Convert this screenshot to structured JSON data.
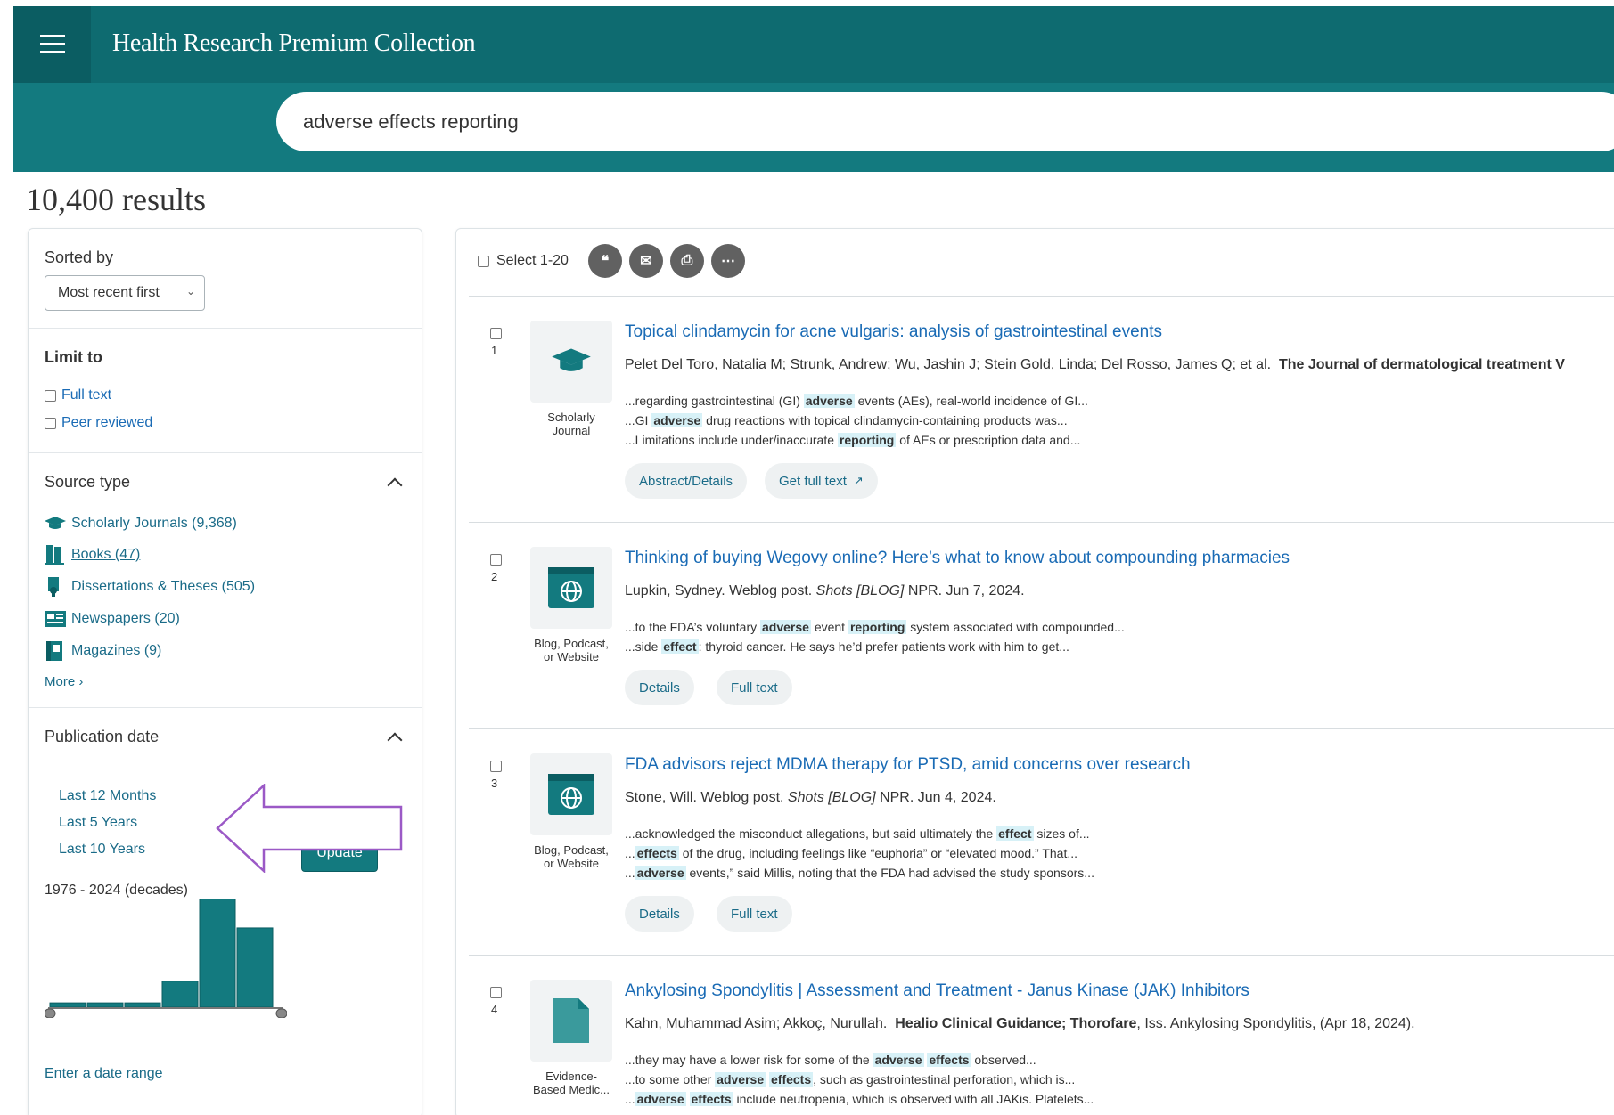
{
  "app": {
    "title": "Health Research Premium Collection"
  },
  "search": {
    "query": "adverse effects reporting"
  },
  "results_count": "10,400 results",
  "sidebar": {
    "sorted_by_label": "Sorted by",
    "sort_value": "Most recent first",
    "limit_to_label": "Limit to",
    "limit_options": [
      "Full text",
      "Peer reviewed"
    ],
    "source_type_label": "Source type",
    "source_types": [
      "Scholarly Journals (9,368)",
      "Books (47)",
      "Dissertations & Theses (505)",
      "Newspapers (20)",
      "Magazines (9)"
    ],
    "more_label": "More ›",
    "publication_date_label": "Publication date",
    "date_links": [
      "Last 12 Months",
      "Last 5 Years",
      "Last 10 Years"
    ],
    "range_caption": "1976 - 2024 (decades)",
    "histogram_levels": [
      0.04,
      0.04,
      0.04,
      0.24,
      1.0,
      0.73
    ],
    "enter_range_label": "Enter a date range",
    "update_label": "Update"
  },
  "toolbar": {
    "select_label": "Select 1-20",
    "icons": [
      "cite-icon",
      "email-icon",
      "print-icon",
      "more-icon"
    ]
  },
  "results": [
    {
      "num": "1",
      "type_icon": "graduation-cap-icon",
      "type_label": [
        "Scholarly",
        "Journal"
      ],
      "title": "Topical clindamycin for acne vulgaris: analysis of gastrointestinal events",
      "meta_plain": "Pelet Del Toro, Natalia M; Strunk, Andrew; Wu, Jashin J; Stein Gold, Linda; Del Rosso, James Q; et al.",
      "meta_bold": "The Journal of dermatological treatment V",
      "snippets": [
        [
          "...regarding gastrointestinal (GI) ",
          "adverse",
          " events (AEs), real-world incidence of GI..."
        ],
        [
          "...GI ",
          "adverse",
          " drug reactions with topical clindamycin-containing products was..."
        ],
        [
          "...Limitations include under/inaccurate ",
          "reporting",
          " of AEs or prescription data and..."
        ]
      ],
      "buttons": [
        "Abstract/Details",
        "Get full text"
      ]
    },
    {
      "num": "2",
      "type_icon": "web-globe-icon",
      "type_label": [
        "Blog, Podcast,",
        "or Website"
      ],
      "title": "Thinking of buying Wegovy online? Here’s what to know about compounding pharmacies",
      "meta_plain": "Lupkin, Sydney.  Weblog post.",
      "meta_italic": "Shots [BLOG]",
      "meta_tail": " NPR.  Jun 7, 2024.",
      "snippets2": [
        [
          "...to the FDA’s voluntary ",
          "adverse",
          " event ",
          "reporting",
          " system associated with compounded..."
        ],
        [
          "...side ",
          "effect",
          ": thyroid cancer. He says he’d prefer patients work with him to get..."
        ]
      ],
      "buttons": [
        "Details",
        "Full text"
      ]
    },
    {
      "num": "3",
      "type_icon": "web-globe-icon",
      "type_label": [
        "Blog, Podcast,",
        "or Website"
      ],
      "title": "FDA advisors reject MDMA therapy for PTSD, amid concerns over research",
      "meta_plain": "Stone, Will.  Weblog post.",
      "meta_italic": "Shots [BLOG]",
      "meta_tail": " NPR.  Jun 4, 2024.",
      "snippets": [
        [
          "...acknowledged the misconduct allegations, but said ultimately the ",
          "effect",
          " sizes of..."
        ],
        [
          "...",
          "effects",
          " of the drug, including feelings like “euphoria” or “elevated mood.” That..."
        ],
        [
          "...",
          "adverse",
          " events,” said Millis, noting that the FDA had advised the study sponsors..."
        ]
      ],
      "buttons": [
        "Details",
        "Full text"
      ]
    },
    {
      "num": "4",
      "type_icon": "document-icon",
      "type_label": [
        "Evidence-",
        "Based Medic..."
      ],
      "title": "Ankylosing Spondylitis | Assessment and Treatment - Janus Kinase (JAK) Inhibitors",
      "meta_plain": "Kahn, Muhammad Asim; Akkoç, Nurullah.",
      "meta_bold": "Healio Clinical Guidance; Thorofare",
      "meta_tail": ",  Iss. Ankylosing Spondylitis, (Apr 18, 2024).",
      "snippets_multi": [
        [
          "...they may have a lower risk for some of the ",
          "adverse",
          " ",
          "effects",
          " observed..."
        ],
        [
          "...to some other ",
          "adverse",
          " ",
          "effects",
          ", such as gastrointestinal perforation, which is..."
        ],
        [
          "...",
          "adverse",
          " ",
          "effects",
          " include neutropenia, which is observed with all JAKis. Platelets..."
        ]
      ]
    }
  ],
  "colors": {
    "teal_dark": "#0e6b70",
    "teal": "#137a7f",
    "link": "#1a6bb5",
    "highlight": "#d7f1f7",
    "annotation_arrow": "#9b59c6"
  }
}
